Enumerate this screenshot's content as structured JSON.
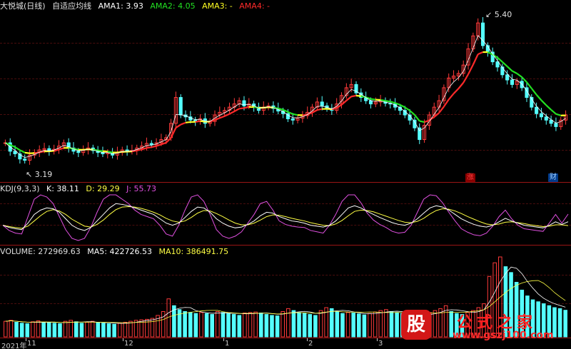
{
  "price_panel": {
    "stock_name": "大悦城(日线)",
    "indicator_name": "自适应均线",
    "ama1_label": "AMA1: 3.93",
    "ama2_label": "AMA2: 4.05",
    "ama3_label": "AMA3: -",
    "ama4_label": "AMA4: -",
    "high_label": "5.40",
    "low_label": "3.19",
    "limit_up_badge": "涨",
    "finance_badge": "财"
  },
  "kdj_panel": {
    "title": "KDJ(9,3,3)",
    "k_label": "K: 38.11",
    "d_label": "D: 29.29",
    "j_label": "J: 55.73"
  },
  "volume_panel": {
    "title": "VOLUME: 272969.63",
    "ma5_label": "MA5: 422726.53",
    "ma10_label": "MA10: 386491.75"
  },
  "x_axis": {
    "labels": [
      "2021年",
      "11",
      "12",
      "1",
      "2",
      "3"
    ]
  },
  "watermark": {
    "icon_text": "股",
    "brand": "公式之家",
    "url": "www.gszj100.com"
  },
  "colors": {
    "background": "#000000",
    "up_candle": "#ff3a3a",
    "down_candle": "#54ffff",
    "ama1": "#ffffff",
    "ama2": "#22e022",
    "ama3": "#ffff22",
    "ama4": "#ff2a2a",
    "kdj_k": "#ffffff",
    "kdj_d": "#ffff44",
    "kdj_j": "#e050e0",
    "panel_separator": "#9a1414"
  },
  "chart_data": {
    "type": "candlestick",
    "price_series_close": [
      3.55,
      3.42,
      3.38,
      3.3,
      3.28,
      3.36,
      3.4,
      3.44,
      3.46,
      3.42,
      3.45,
      3.5,
      3.55,
      3.47,
      3.42,
      3.4,
      3.44,
      3.47,
      3.43,
      3.4,
      3.38,
      3.4,
      3.36,
      3.4,
      3.44,
      3.42,
      3.43,
      3.47,
      3.5,
      3.54,
      3.52,
      3.55,
      3.6,
      3.63,
      3.85,
      4.25,
      3.98,
      3.95,
      3.9,
      3.88,
      3.92,
      3.85,
      3.88,
      3.98,
      4.02,
      4.05,
      4.1,
      4.15,
      4.2,
      4.12,
      4.15,
      4.1,
      4.05,
      4.1,
      4.12,
      4.08,
      4.04,
      4.0,
      3.92,
      3.9,
      3.93,
      3.97,
      4.02,
      4.1,
      4.18,
      4.12,
      4.08,
      4.05,
      4.15,
      4.28,
      4.4,
      4.45,
      4.32,
      4.25,
      4.2,
      4.15,
      4.18,
      4.2,
      4.16,
      4.15,
      4.1,
      4.05,
      3.98,
      3.9,
      3.78,
      3.6,
      3.82,
      3.98,
      4.1,
      4.2,
      4.4,
      4.55,
      4.58,
      4.62,
      4.75,
      5.0,
      5.2,
      5.4,
      5.05,
      4.95,
      4.8,
      4.72,
      4.6,
      4.52,
      4.45,
      4.5,
      4.4,
      4.25,
      4.1,
      4.0,
      3.95,
      3.9,
      3.85,
      3.8,
      3.9,
      3.98
    ],
    "kdj": {
      "k": [
        30,
        25,
        22,
        20,
        35,
        55,
        65,
        70,
        68,
        60,
        45,
        30,
        22,
        18,
        25,
        40,
        55,
        70,
        80,
        78,
        75,
        70,
        65,
        60,
        55,
        45,
        35,
        30,
        35,
        48,
        62,
        72,
        70,
        60,
        45,
        35,
        28,
        24,
        26,
        32,
        40,
        52,
        60,
        58,
        50,
        45,
        40,
        38,
        35,
        30,
        28,
        26,
        30,
        40,
        55,
        70,
        75,
        70,
        62,
        55,
        48,
        42,
        36,
        32,
        30,
        35,
        45,
        58,
        70,
        75,
        72,
        65,
        55,
        45,
        38,
        32,
        28,
        26,
        30,
        38,
        46,
        40,
        35,
        30,
        28,
        26,
        24,
        30,
        38,
        32,
        38.11
      ],
      "d": [
        30,
        27,
        25,
        23,
        28,
        40,
        52,
        62,
        66,
        63,
        55,
        44,
        36,
        28,
        26,
        32,
        42,
        55,
        66,
        72,
        73,
        72,
        69,
        65,
        60,
        54,
        46,
        40,
        37,
        40,
        48,
        58,
        64,
        63,
        57,
        50,
        42,
        35,
        31,
        31,
        35,
        42,
        50,
        54,
        53,
        50,
        46,
        43,
        40,
        36,
        33,
        30,
        29,
        33,
        41,
        52,
        62,
        65,
        64,
        61,
        56,
        51,
        46,
        41,
        37,
        36,
        39,
        46,
        56,
        64,
        68,
        67,
        63,
        57,
        50,
        44,
        38,
        33,
        31,
        33,
        37,
        38,
        36,
        34,
        31,
        29,
        27,
        28,
        31,
        31,
        29.29
      ],
      "j": [
        30,
        18,
        12,
        10,
        50,
        90,
        100,
        95,
        80,
        50,
        20,
        0,
        -5,
        0,
        25,
        60,
        90,
        100,
        100,
        90,
        80,
        65,
        55,
        50,
        45,
        30,
        10,
        5,
        30,
        65,
        95,
        100,
        85,
        55,
        20,
        5,
        0,
        5,
        15,
        35,
        55,
        80,
        85,
        65,
        40,
        32,
        28,
        26,
        25,
        18,
        15,
        12,
        30,
        55,
        85,
        100,
        100,
        82,
        58,
        42,
        32,
        25,
        16,
        12,
        14,
        30,
        60,
        90,
        100,
        98,
        82,
        60,
        40,
        22,
        14,
        8,
        6,
        12,
        28,
        50,
        65,
        45,
        30,
        22,
        20,
        18,
        16,
        35,
        55,
        35,
        55.73
      ]
    },
    "volume": [
      160,
      170,
      150,
      140,
      135,
      155,
      165,
      150,
      148,
      140,
      135,
      160,
      170,
      155,
      140,
      150,
      160,
      145,
      140,
      135,
      130,
      140,
      150,
      160,
      170,
      175,
      180,
      190,
      220,
      260,
      390,
      320,
      280,
      260,
      250,
      240,
      250,
      240,
      230,
      260,
      250,
      240,
      230,
      220,
      245,
      250,
      255,
      245,
      230,
      220,
      215,
      260,
      290,
      270,
      250,
      240,
      230,
      220,
      270,
      300,
      290,
      260,
      240,
      250,
      245,
      235,
      225,
      240,
      255,
      270,
      280,
      260,
      250,
      240,
      230,
      220,
      215,
      230,
      250,
      270,
      290,
      320,
      260,
      240,
      230,
      250,
      270,
      300,
      340,
      620,
      760,
      820,
      720,
      660,
      560,
      480,
      420,
      380,
      360,
      340,
      320,
      300,
      290,
      272.97
    ],
    "price_range": [
      3.0,
      5.6
    ],
    "y_grid": true
  }
}
